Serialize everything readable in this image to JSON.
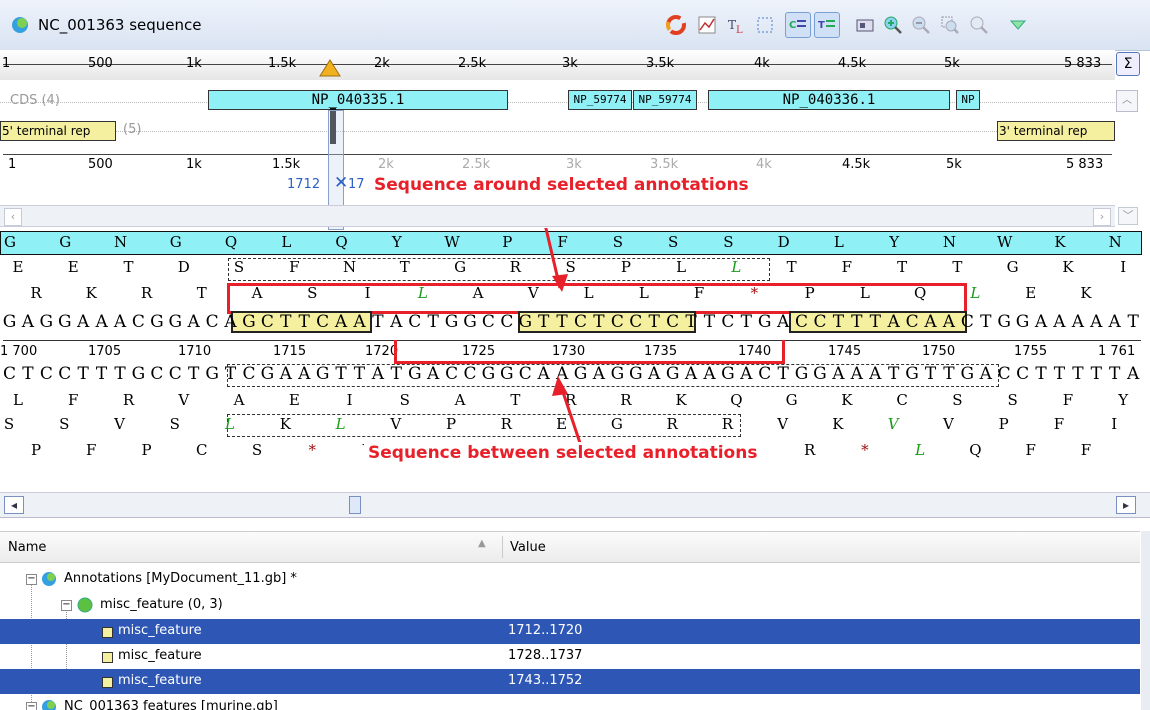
{
  "window": {
    "title": "NC_001363 sequence"
  },
  "toolbar": {
    "icons": [
      "pie-icon",
      "chart-icon",
      "text-case-icon",
      "select-icon",
      "cs-icon",
      "ts-icon",
      "image-icon",
      "zoom-in-icon",
      "zoom-out-icon",
      "zoom-fit-icon",
      "zoom-icon",
      "dropdown-icon"
    ]
  },
  "overview_ruler": {
    "ticks": [
      "1",
      "500",
      "1k",
      "1.5k",
      "2k",
      "2.5k",
      "3k",
      "3.5k",
      "4k",
      "4.5k",
      "5k",
      "5 833"
    ]
  },
  "tracks": {
    "cds_label": "CDS (4)",
    "cds": [
      "NP_040335.1",
      "NP_59774",
      "NP_59774",
      "NP_040336.1",
      "NP"
    ],
    "terminal_label": "(5)",
    "terminal": [
      "5' terminal rep",
      "3' terminal rep"
    ]
  },
  "detail_ruler": {
    "ticks": [
      "1",
      "500",
      "1k",
      "1.5k",
      "2k",
      "2.5k",
      "3k",
      "3.5k",
      "4k",
      "4.5k",
      "5k",
      "5 833"
    ]
  },
  "selection_label": "1712",
  "selection_label2": "17",
  "callouts": {
    "top": "Sequence around selected annotations",
    "bottom": "Sequence between selected annotations"
  },
  "sequence": {
    "frame_top": [
      "G",
      "G",
      "N",
      "G",
      "Q",
      "L",
      "Q",
      "Y",
      "W",
      "P",
      "F",
      "S",
      "S",
      "S",
      "D",
      "L",
      "Y",
      "N",
      "W",
      "K",
      "N"
    ],
    "aa1": [
      "E",
      "E",
      "T",
      "D",
      "S",
      "F",
      "N",
      "T",
      "G",
      "R",
      "S",
      "P",
      "L",
      "L",
      "T",
      "F",
      "T",
      "T",
      "G",
      "K",
      "I"
    ],
    "aa2": [
      "R",
      "K",
      "R",
      "T",
      "A",
      "S",
      "I",
      "L",
      "A",
      "V",
      "L",
      "L",
      "F",
      "*",
      "P",
      "L",
      "Q",
      "L",
      "E",
      "K"
    ],
    "forward": "GAGGAAACGGACAGCTTCAATACTGGCCGTTCTCCTCTTCTGACCTTTACAACTGGAAAAAT",
    "positions": [
      "1 700",
      "1705",
      "1710",
      "1715",
      "1720",
      "1725",
      "1730",
      "1735",
      "1740",
      "1745",
      "1750",
      "1755",
      "1 761"
    ],
    "reverse": "CTCCTTTGCCTGTCGAAGTTATGACCGGCAAGAGGAGAAGACTGGAAATGTTGACCTTTTTA",
    "aa3": [
      "L",
      "F",
      "R",
      "V",
      "A",
      "E",
      "I",
      "S",
      "A",
      "T",
      "R",
      "R",
      "K",
      "Q",
      "G",
      "K",
      "C",
      "S",
      "S",
      "F",
      "Y"
    ],
    "aa4": [
      "S",
      "S",
      "V",
      "S",
      "L",
      "K",
      "L",
      "V",
      "P",
      "R",
      "E",
      "G",
      "R",
      "R",
      "V",
      "K",
      "V",
      "V",
      "P",
      "F",
      "I"
    ],
    "aa5": [
      "P",
      "F",
      "P",
      "C",
      "S",
      "*",
      "Y",
      "Q",
      "G",
      "N",
      "E",
      "E",
      "E",
      "S",
      "R",
      "*",
      "L",
      "Q",
      "F",
      "F"
    ]
  },
  "table": {
    "col_name": "Name",
    "col_value": "Value",
    "rows": [
      {
        "name": "Annotations [MyDocument_11.gb] *",
        "value": ""
      },
      {
        "name": "misc_feature  (0, 3)",
        "value": ""
      },
      {
        "name": "misc_feature",
        "value": "1712..1720"
      },
      {
        "name": "misc_feature",
        "value": "1728..1737"
      },
      {
        "name": "misc_feature",
        "value": "1743..1752"
      },
      {
        "name": "NC_001363 features [murine.gb]",
        "value": ""
      }
    ]
  },
  "colors": {
    "accent": "#2e57b5",
    "cds": "#8ff0f5",
    "terminal": "#f5f0a0",
    "callout": "#e8202a",
    "highlight": "#f5f0a0"
  }
}
